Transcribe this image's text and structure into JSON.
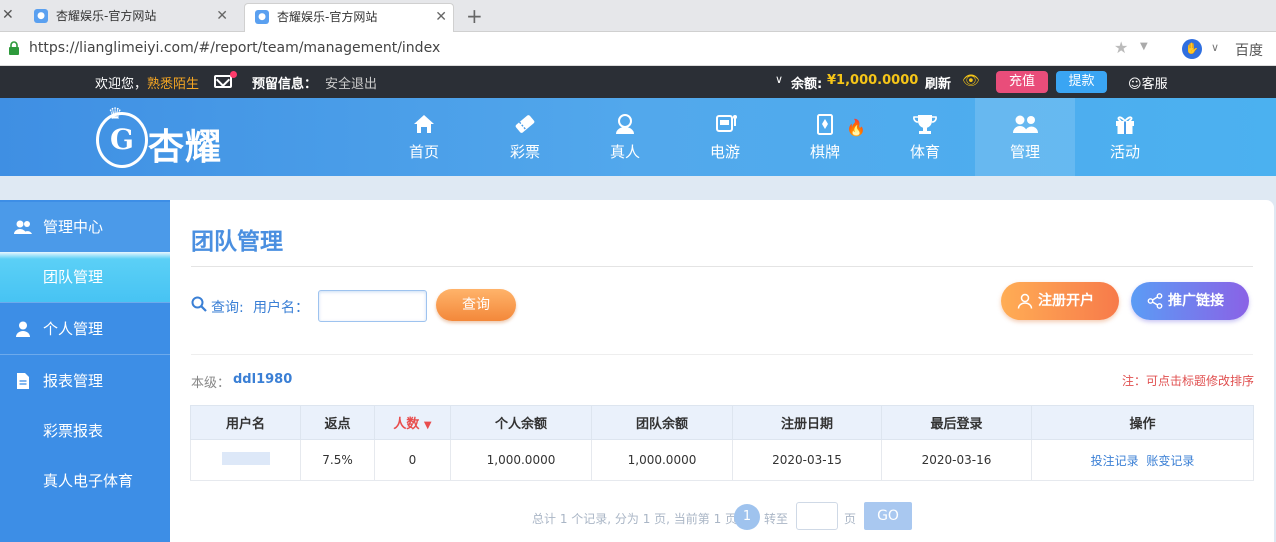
{
  "browser": {
    "tabs": [
      {
        "title": "杏耀娱乐-官方网站"
      },
      {
        "title": "杏耀娱乐-官方网站"
      }
    ],
    "url": "https://lianglimeiyi.com/#/report/team/management/index",
    "search_engine": "百度"
  },
  "topbar": {
    "welcome": "欢迎您，",
    "username": "熟悉陌生",
    "warn_label": "预留信息：",
    "logout": "安全退出",
    "balance_label": "余额:",
    "balance_value": "¥1,000.0000",
    "refresh": "刷新",
    "recharge": "充值",
    "withdraw": "提款",
    "service": "客服"
  },
  "logo": {
    "text": "杏耀",
    "mark": "G"
  },
  "nav": {
    "items": [
      {
        "label": "首页",
        "icon": "home-icon"
      },
      {
        "label": "彩票",
        "icon": "lottery-ticket-icon"
      },
      {
        "label": "真人",
        "icon": "live-dealer-icon"
      },
      {
        "label": "电游",
        "icon": "slot-machine-icon"
      },
      {
        "label": "棋牌",
        "icon": "playing-card-icon"
      },
      {
        "label": "体育",
        "icon": "trophy-icon"
      },
      {
        "label": "管理",
        "icon": "users-icon"
      },
      {
        "label": "活动",
        "icon": "gift-icon"
      }
    ],
    "active_index": 6
  },
  "sidebar": {
    "items": [
      {
        "label": "管理中心",
        "type": "header"
      },
      {
        "label": "团队管理",
        "type": "selected"
      },
      {
        "label": "个人管理",
        "type": "header"
      },
      {
        "label": "报表管理",
        "type": "header"
      },
      {
        "label": "彩票报表",
        "type": "sub"
      },
      {
        "label": "真人电子体育",
        "type": "sub"
      }
    ]
  },
  "main": {
    "title": "团队管理",
    "search_label": "查询:",
    "username_label": "用户名：",
    "username_value": "",
    "query_button": "查询",
    "register_button": "注册开户",
    "promo_button": "推广链接",
    "level_label": "本级：",
    "level_value": "ddl1980",
    "note": "注：可点击标题修改排序"
  },
  "table": {
    "headers": [
      "用户名",
      "返点",
      "人数",
      "个人余额",
      "团队余额",
      "注册日期",
      "最后登录",
      "操作"
    ],
    "rows": [
      {
        "rebate": "7.5%",
        "count": "0",
        "personal_balance": "1,000.0000",
        "team_balance": "1,000.0000",
        "reg_date": "2020-03-15",
        "last_login": "2020-03-16",
        "op1": "投注记录",
        "op2": "账变记录"
      }
    ]
  },
  "pager": {
    "info": "总计 1 个记录, 分为 1 页, 当前第 1 页",
    "current": "1",
    "goto": "转至",
    "page_unit": "页",
    "go": "GO"
  },
  "colors": {
    "nav_blue": "#4a9ce8",
    "accent_orange": "#f3883a",
    "accent_purple": "#8a62e6",
    "balance_gold": "#f5c518"
  }
}
